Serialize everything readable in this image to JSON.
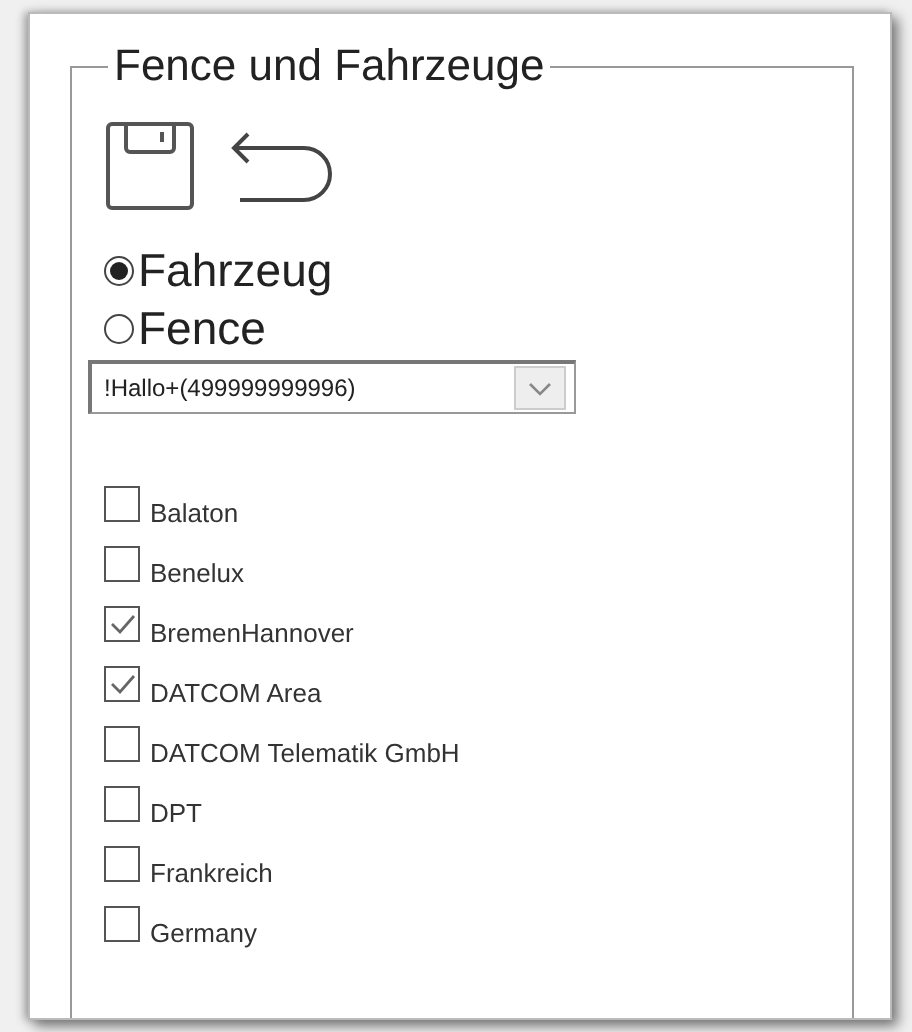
{
  "group": {
    "title": "Fence und Fahrzeuge"
  },
  "mode_options": [
    {
      "label": "Fahrzeug",
      "selected": true
    },
    {
      "label": "Fence",
      "selected": false
    }
  ],
  "vehicle_select": {
    "value": "!Hallo+(499999999996)"
  },
  "areas": [
    {
      "label": "Balaton",
      "checked": false
    },
    {
      "label": "Benelux",
      "checked": false
    },
    {
      "label": "BremenHannover",
      "checked": true
    },
    {
      "label": "DATCOM Area",
      "checked": true
    },
    {
      "label": "DATCOM Telematik GmbH",
      "checked": false
    },
    {
      "label": "DPT",
      "checked": false
    },
    {
      "label": "Frankreich",
      "checked": false
    },
    {
      "label": "Germany",
      "checked": false
    }
  ]
}
